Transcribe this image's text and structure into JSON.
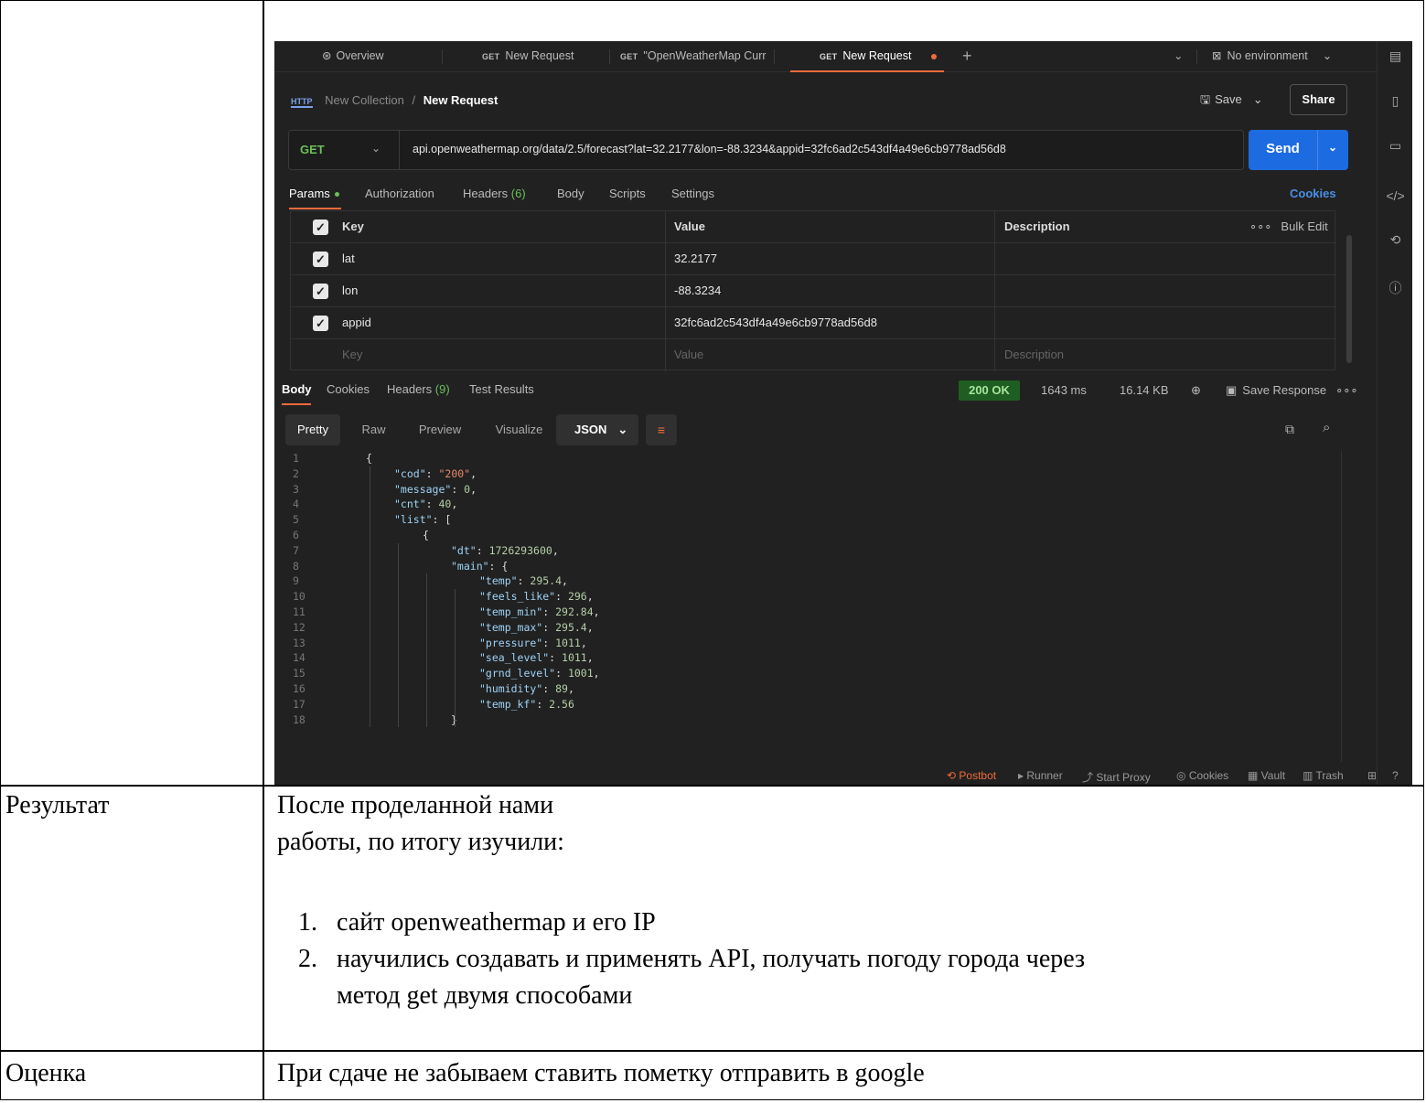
{
  "postman": {
    "tabs": [
      {
        "label": "Overview",
        "method": ""
      },
      {
        "label": "New Request",
        "method": "GET"
      },
      {
        "label": "\"OpenWeatherMap Curr",
        "method": "GET"
      },
      {
        "label": "New Request",
        "method": "GET"
      }
    ],
    "environment": "No environment",
    "breadcrumb": {
      "collection": "New Collection",
      "separator": "/",
      "request": "New Request",
      "http_badge": "HTTP"
    },
    "save_label": "Save",
    "share_label": "Share",
    "method": "GET",
    "url": "api.openweathermap.org/data/2.5/forecast?lat=32.2177&lon=-88.3234&appid=32fc6ad2c543df4a49e6cb9778ad56d8",
    "send_label": "Send",
    "request_tabs": [
      {
        "label": "Params",
        "count": ""
      },
      {
        "label": "Authorization",
        "count": ""
      },
      {
        "label": "Headers",
        "count": "(6)"
      },
      {
        "label": "Body",
        "count": ""
      },
      {
        "label": "Scripts",
        "count": ""
      },
      {
        "label": "Settings",
        "count": ""
      }
    ],
    "cookies_link": "Cookies",
    "params_table": {
      "headers": {
        "key": "Key",
        "value": "Value",
        "description": "Description",
        "bulk_edit": "Bulk Edit"
      },
      "rows": [
        {
          "key": "lat",
          "value": "32.2177"
        },
        {
          "key": "lon",
          "value": "-88.3234"
        },
        {
          "key": "appid",
          "value": "32fc6ad2c543df4a49e6cb9778ad56d8"
        }
      ],
      "placeholder": {
        "key": "Key",
        "value": "Value",
        "description": "Description"
      }
    },
    "response_tabs": [
      {
        "label": "Body",
        "count": ""
      },
      {
        "label": "Cookies",
        "count": ""
      },
      {
        "label": "Headers",
        "count": "(9)"
      },
      {
        "label": "Test Results",
        "count": ""
      }
    ],
    "status": "200 OK",
    "time": "1643 ms",
    "size": "16.14 KB",
    "save_response": "Save Response",
    "view_modes": [
      "Pretty",
      "Raw",
      "Preview",
      "Visualize"
    ],
    "format": "JSON",
    "code_lines": [
      {
        "n": "1",
        "indent": 0,
        "parts": [
          [
            "p",
            "{"
          ]
        ]
      },
      {
        "n": "2",
        "indent": 1,
        "parts": [
          [
            "k",
            "\"cod\""
          ],
          [
            "p",
            ": "
          ],
          [
            "s",
            "\"200\""
          ],
          [
            "p",
            ","
          ]
        ]
      },
      {
        "n": "3",
        "indent": 1,
        "parts": [
          [
            "k",
            "\"message\""
          ],
          [
            "p",
            ": "
          ],
          [
            "n",
            "0"
          ],
          [
            "p",
            ","
          ]
        ]
      },
      {
        "n": "4",
        "indent": 1,
        "parts": [
          [
            "k",
            "\"cnt\""
          ],
          [
            "p",
            ": "
          ],
          [
            "n",
            "40"
          ],
          [
            "p",
            ","
          ]
        ]
      },
      {
        "n": "5",
        "indent": 1,
        "parts": [
          [
            "k",
            "\"list\""
          ],
          [
            "p",
            ": ["
          ]
        ]
      },
      {
        "n": "6",
        "indent": 2,
        "parts": [
          [
            "p",
            "{"
          ]
        ]
      },
      {
        "n": "7",
        "indent": 3,
        "parts": [
          [
            "k",
            "\"dt\""
          ],
          [
            "p",
            ": "
          ],
          [
            "n",
            "1726293600"
          ],
          [
            "p",
            ","
          ]
        ]
      },
      {
        "n": "8",
        "indent": 3,
        "parts": [
          [
            "k",
            "\"main\""
          ],
          [
            "p",
            ": {"
          ]
        ]
      },
      {
        "n": "9",
        "indent": 4,
        "parts": [
          [
            "k",
            "\"temp\""
          ],
          [
            "p",
            ": "
          ],
          [
            "n",
            "295.4"
          ],
          [
            "p",
            ","
          ]
        ]
      },
      {
        "n": "10",
        "indent": 4,
        "parts": [
          [
            "k",
            "\"feels_like\""
          ],
          [
            "p",
            ": "
          ],
          [
            "n",
            "296"
          ],
          [
            "p",
            ","
          ]
        ]
      },
      {
        "n": "11",
        "indent": 4,
        "parts": [
          [
            "k",
            "\"temp_min\""
          ],
          [
            "p",
            ": "
          ],
          [
            "n",
            "292.84"
          ],
          [
            "p",
            ","
          ]
        ]
      },
      {
        "n": "12",
        "indent": 4,
        "parts": [
          [
            "k",
            "\"temp_max\""
          ],
          [
            "p",
            ": "
          ],
          [
            "n",
            "295.4"
          ],
          [
            "p",
            ","
          ]
        ]
      },
      {
        "n": "13",
        "indent": 4,
        "parts": [
          [
            "k",
            "\"pressure\""
          ],
          [
            "p",
            ": "
          ],
          [
            "n",
            "1011"
          ],
          [
            "p",
            ","
          ]
        ]
      },
      {
        "n": "14",
        "indent": 4,
        "parts": [
          [
            "k",
            "\"sea_level\""
          ],
          [
            "p",
            ": "
          ],
          [
            "n",
            "1011"
          ],
          [
            "p",
            ","
          ]
        ]
      },
      {
        "n": "15",
        "indent": 4,
        "parts": [
          [
            "k",
            "\"grnd_level\""
          ],
          [
            "p",
            ": "
          ],
          [
            "n",
            "1001"
          ],
          [
            "p",
            ","
          ]
        ]
      },
      {
        "n": "16",
        "indent": 4,
        "parts": [
          [
            "k",
            "\"humidity\""
          ],
          [
            "p",
            ": "
          ],
          [
            "n",
            "89"
          ],
          [
            "p",
            ","
          ]
        ]
      },
      {
        "n": "17",
        "indent": 4,
        "parts": [
          [
            "k",
            "\"temp_kf\""
          ],
          [
            "p",
            ": "
          ],
          [
            "n",
            "2.56"
          ]
        ]
      },
      {
        "n": "18",
        "indent": 3,
        "parts": [
          [
            "p",
            "}"
          ]
        ]
      }
    ],
    "statusbar": [
      "Postbot",
      "Runner",
      "Start Proxy",
      "Cookies",
      "Vault",
      "Trash"
    ]
  },
  "document": {
    "result_label": "Результат",
    "result_intro_1": "После проделанной нами",
    "result_intro_2": "работы, по итогу изучили:",
    "result_items": [
      "сайт openweathermap и его IP",
      "научились создавать и применять API, получать погоду города через",
      "метод get двумя способами"
    ],
    "result_markers": [
      "1.",
      "2."
    ],
    "grade_label": "Оценка",
    "grade_text": "При сдаче не забываем ставить пометку отправить в google"
  },
  "colors": {
    "accent": "#f26b3a",
    "send": "#1d6be0",
    "status_ok": "#1f5e22",
    "get": "#6bbf59"
  }
}
